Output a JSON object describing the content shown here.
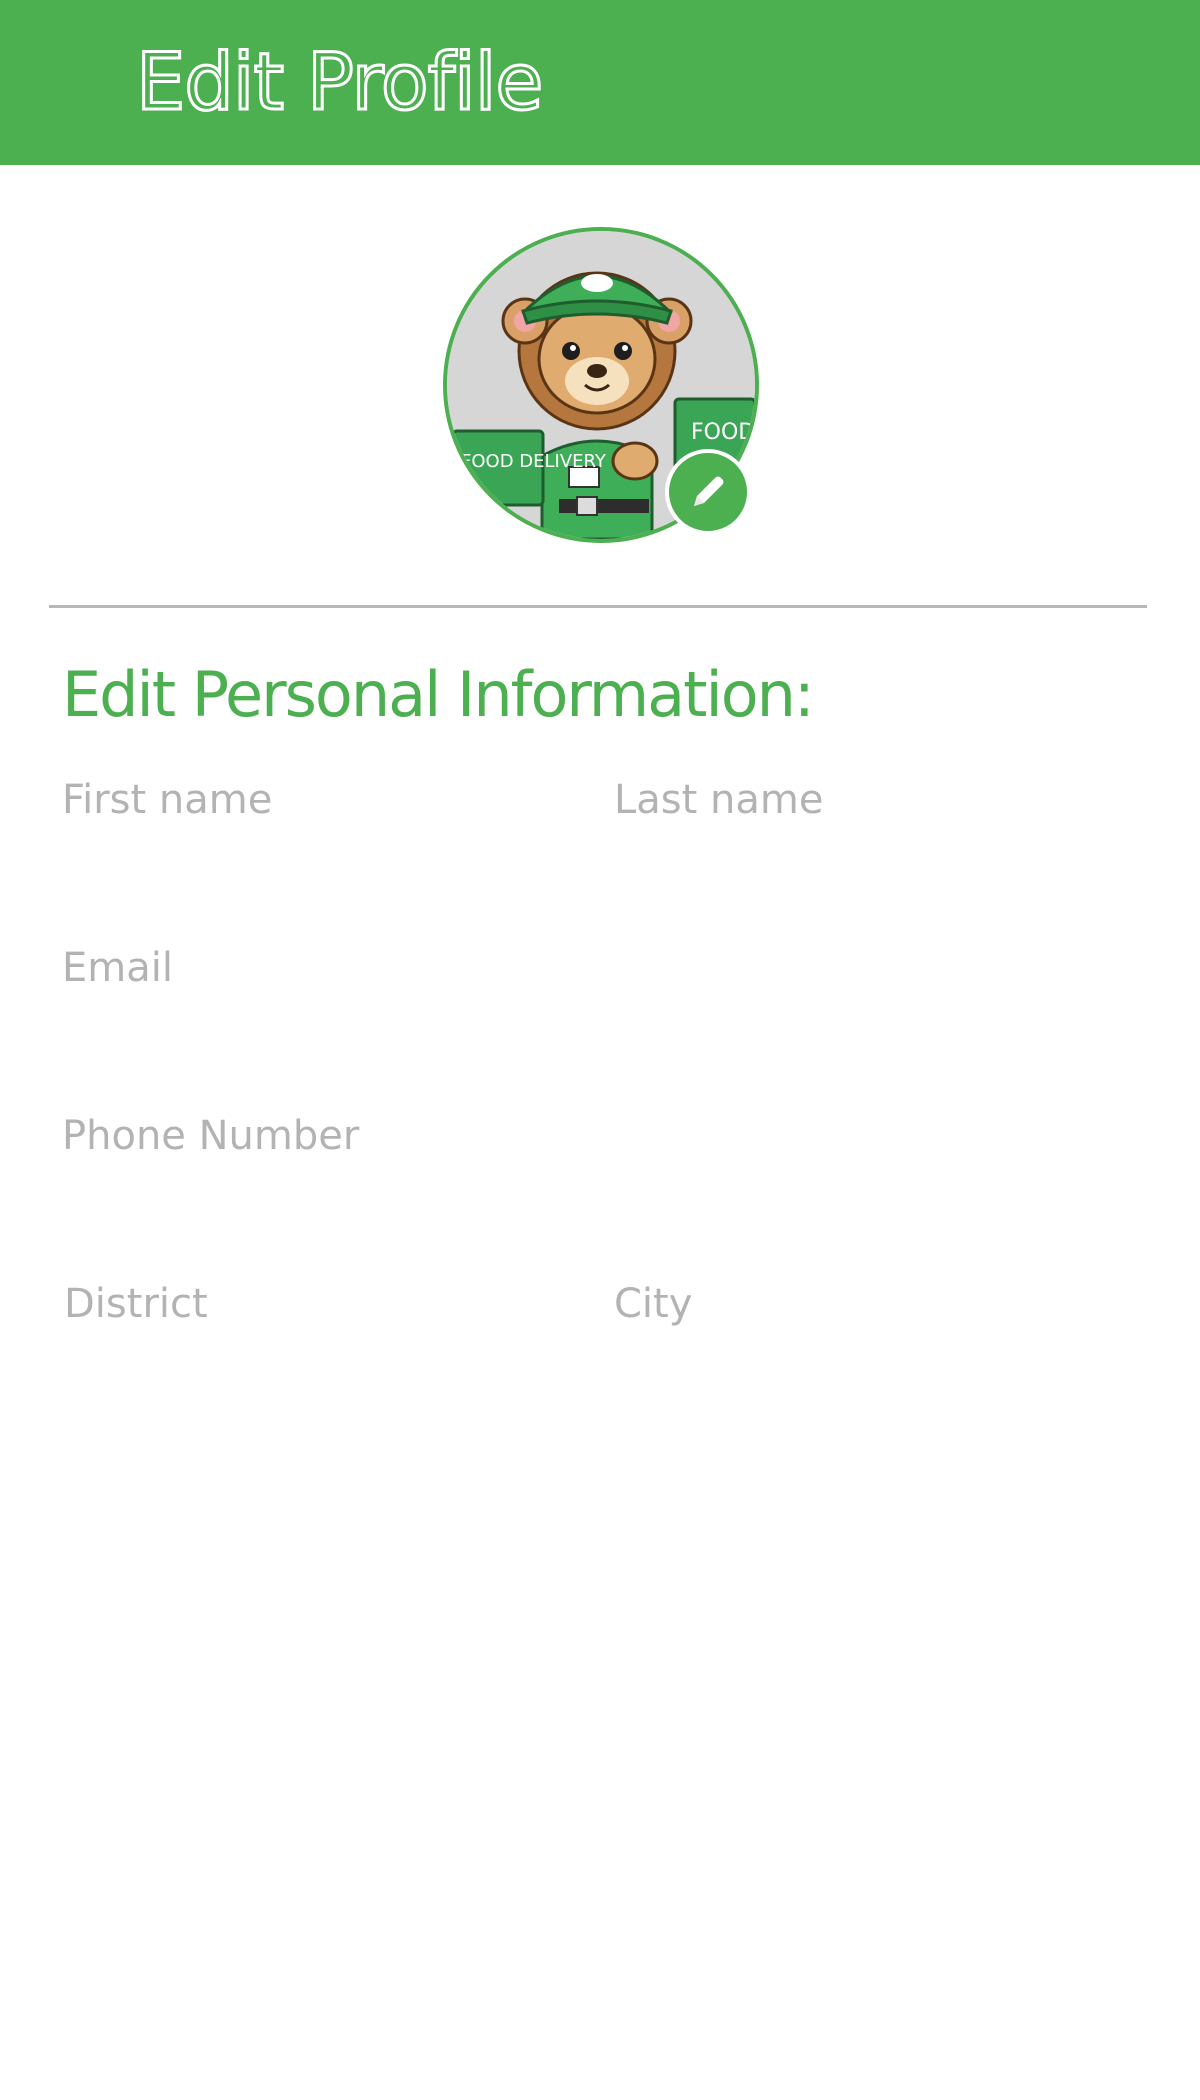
{
  "app_bar": {
    "title": "Edit Profile",
    "color": "#4CAF50"
  },
  "profile": {
    "avatar_description_icon": "lion-courier-avatar",
    "edit_icon": "pencil-icon",
    "avatar_text_left": "FOOD DELIVERY",
    "avatar_text_right": "FOOD DELIVERY"
  },
  "section": {
    "heading": "Edit Personal Information:"
  },
  "form": {
    "first_name": {
      "value": "",
      "placeholder": "First name"
    },
    "last_name": {
      "value": "",
      "placeholder": "Last name"
    },
    "email": {
      "value": "",
      "placeholder": "Email"
    },
    "phone": {
      "value": "",
      "placeholder": "Phone Number"
    },
    "district": {
      "value": "",
      "placeholder": "District"
    },
    "city": {
      "value": "",
      "placeholder": "City"
    }
  }
}
